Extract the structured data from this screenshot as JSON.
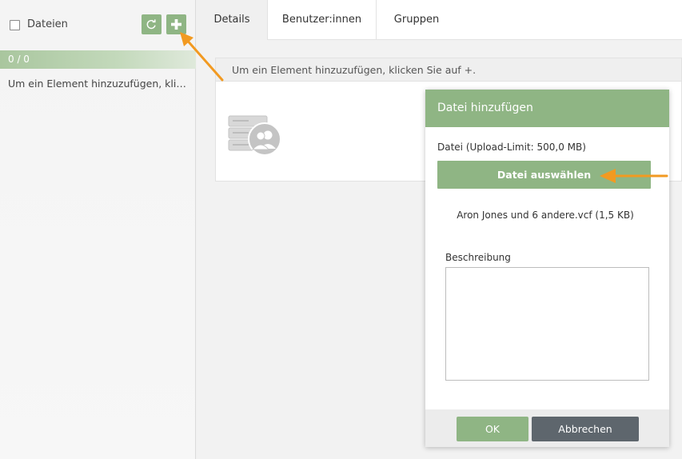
{
  "left": {
    "title": "Dateien",
    "counter": "0 / 0",
    "hint": "Um ein Element hinzuzufügen, klicken Sie auf +."
  },
  "tabs": [
    "Details",
    "Benutzer:innen",
    "Gruppen"
  ],
  "main": {
    "info": "Um ein Element hinzuzufügen, klicken Sie auf +."
  },
  "dialog": {
    "title": "Datei hinzufügen",
    "upload_label": "Datei (Upload-Limit: 500,0 MB)",
    "choose_button": "Datei auswählen",
    "file_name": "Aron Jones und 6 andere.vcf (1,5 KB)",
    "description_label": "Beschreibung",
    "description_value": "",
    "ok": "OK",
    "cancel": "Abbrechen"
  },
  "icons": {
    "refresh": "refresh-icon",
    "add": "plus-icon",
    "illustration": "server-users-icon",
    "annotation": "orange-arrow"
  },
  "colors": {
    "accent": "#8fb584",
    "cancel": "#5e666d",
    "annotation": "#f29a21"
  }
}
